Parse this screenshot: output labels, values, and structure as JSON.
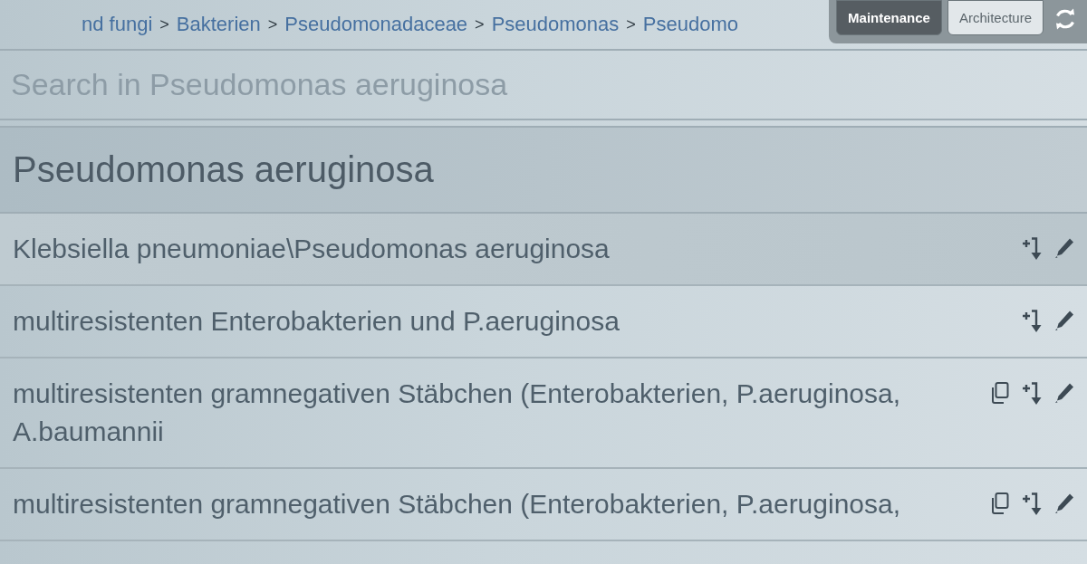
{
  "breadcrumb": {
    "items": [
      "nd fungi",
      "Bakterien",
      "Pseudomonadaceae",
      "Pseudomonas",
      "Pseudomo"
    ],
    "separators": [
      ">",
      ">",
      ">",
      ">"
    ]
  },
  "tabs": [
    {
      "label": "Maintenance",
      "selected": true
    },
    {
      "label": "Architecture",
      "selected": false
    }
  ],
  "search": {
    "placeholder": "Search in Pseudomonas aeruginosa"
  },
  "list": {
    "heading": "Pseudomonas aeruginosa",
    "rows": [
      {
        "text": "Klebsiella pneumoniae\\Pseudomonas aeruginosa",
        "selected": true,
        "actions": [
          {
            "kind": "add"
          },
          {
            "kind": "edit"
          }
        ]
      },
      {
        "text": "multiresistenten Enterobakterien und P.aeruginosa",
        "selected": false,
        "actions": [
          {
            "kind": "add"
          },
          {
            "kind": "edit"
          }
        ]
      },
      {
        "text": "multiresistenten gramnegativen Stäbchen (Enterobakterien, P.aeruginosa, A.baumannii",
        "selected": false,
        "actions": [
          {
            "kind": "copy"
          },
          {
            "kind": "add"
          },
          {
            "kind": "edit"
          }
        ]
      },
      {
        "text": "multiresistenten gramnegativen Stäbchen (Enterobakterien, P.aeruginosa,",
        "selected": false,
        "actions": [
          {
            "kind": "copy"
          },
          {
            "kind": "add"
          },
          {
            "kind": "edit"
          }
        ]
      }
    ]
  }
}
